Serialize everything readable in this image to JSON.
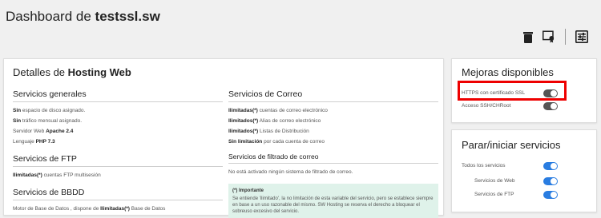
{
  "header": {
    "title_prefix": "Dashboard de ",
    "title_domain": "testssl.sw"
  },
  "toolbar": {
    "icons": [
      "trash-icon",
      "certificate-icon",
      "settings-sliders-icon"
    ]
  },
  "main": {
    "title_prefix": "Detalles de ",
    "title_bold": "Hosting Web",
    "servicios_generales": {
      "title": "Servicios generales",
      "lines": [
        {
          "b": "Sin",
          "t": " espacio de disco asignado."
        },
        {
          "b": "Sin",
          "t": " tráfico mensual asignado."
        },
        {
          "t": "Servidor Web ",
          "b2": "Apache 2.4"
        },
        {
          "t": "Lenguaje ",
          "b2": "PHP 7.3"
        }
      ]
    },
    "ftp": {
      "title": "Servicios de FTP",
      "line_b": "Ilimitadas(*)",
      "line_t": " cuentas FTP multisesión"
    },
    "bbdd": {
      "title": "Servicios de BBDD",
      "line_t": "Motor de Base de Datos , dispone de ",
      "line_b": "Ilimitadas(*)",
      "line_t2": " Base de Datos"
    },
    "correo": {
      "title": "Servicios de Correo",
      "lines": [
        {
          "b": "Ilimitadas(*)",
          "t": " cuentas de correo electrónico"
        },
        {
          "b": "Ilimitados(*)",
          "t": " Alias de correo electrónico"
        },
        {
          "b": "Ilimitados(*)",
          "t": " Listas de Distribución"
        },
        {
          "b": "Sin limitación",
          "t": " por cada cuenta de correo"
        }
      ]
    },
    "filtrado": {
      "title": "Servicios de filtrado de correo",
      "line": "No está activado ningún sistema de filtrado de correo."
    },
    "note": {
      "title": "(*) Importante",
      "body": "Se entiende 'ilimitado', la no limitación de esta variable del servicio, pero se establece siempre en base a un uso razonable del mismo. SW Hosting se reserva el derecho a bloquear el sobreuso excesivo del servicio."
    }
  },
  "mejoras": {
    "title": "Mejoras disponibles",
    "items": [
      {
        "label": "HTTPS con certificado SSL",
        "state": "off"
      },
      {
        "label": "Acceso SSH/CHRoot",
        "state": "off"
      }
    ]
  },
  "parar": {
    "title": "Parar/iniciar servicios",
    "items": [
      {
        "label": "Todos los servicios",
        "state": "on"
      },
      {
        "label": "Servicios de Web",
        "state": "on"
      },
      {
        "label": "Servicios de FTP",
        "state": "on"
      }
    ]
  },
  "colors": {
    "accent": "#2a7de1",
    "highlight": "#ee0000",
    "note_bg": "#dff2ea"
  }
}
